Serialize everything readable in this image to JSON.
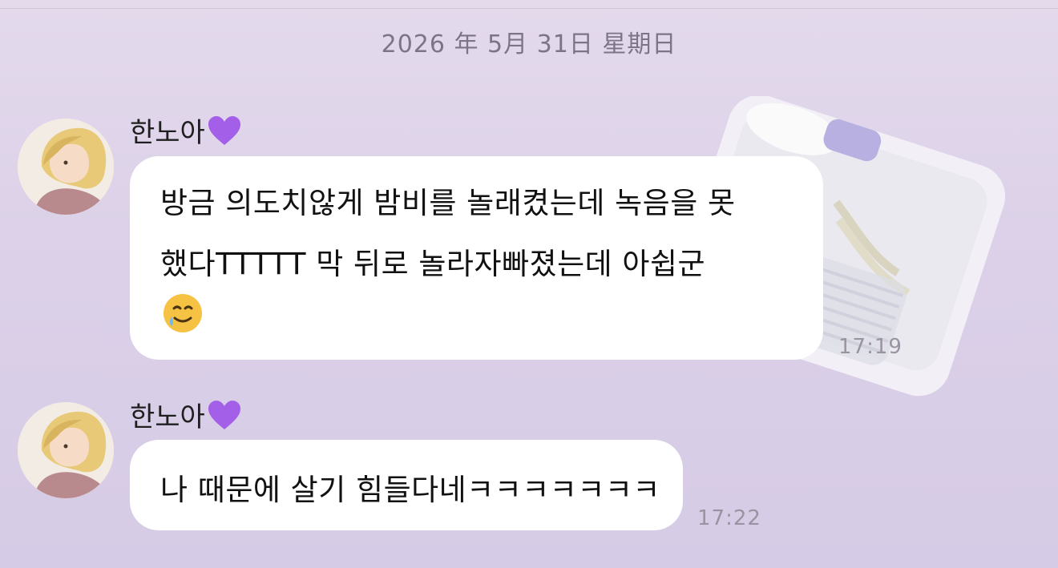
{
  "chat": {
    "date_separator": "2026 年 5月 31日 星期日",
    "messages": [
      {
        "sender": "한노아",
        "sender_emoji": "purple-heart-icon",
        "lines": [
          "방금 의도치않게 밤비를 놀래켰는데 녹음을 못",
          "했다TTTTT 막 뒤로 놀라자빠졌는데 아쉽군"
        ],
        "trailing_emoji": "smiling-face-with-tear-icon",
        "time": "17:19"
      },
      {
        "sender": "한노아",
        "sender_emoji": "purple-heart-icon",
        "lines": [
          "나 때문에 살기 힘들다네ㅋㅋㅋㅋㅋㅋㅋ"
        ],
        "time": "17:22"
      }
    ]
  },
  "colors": {
    "background": "#dcd1e8",
    "bubble": "#ffffff",
    "heart": "#a45fe8",
    "timestamp": "#9a94a2"
  }
}
